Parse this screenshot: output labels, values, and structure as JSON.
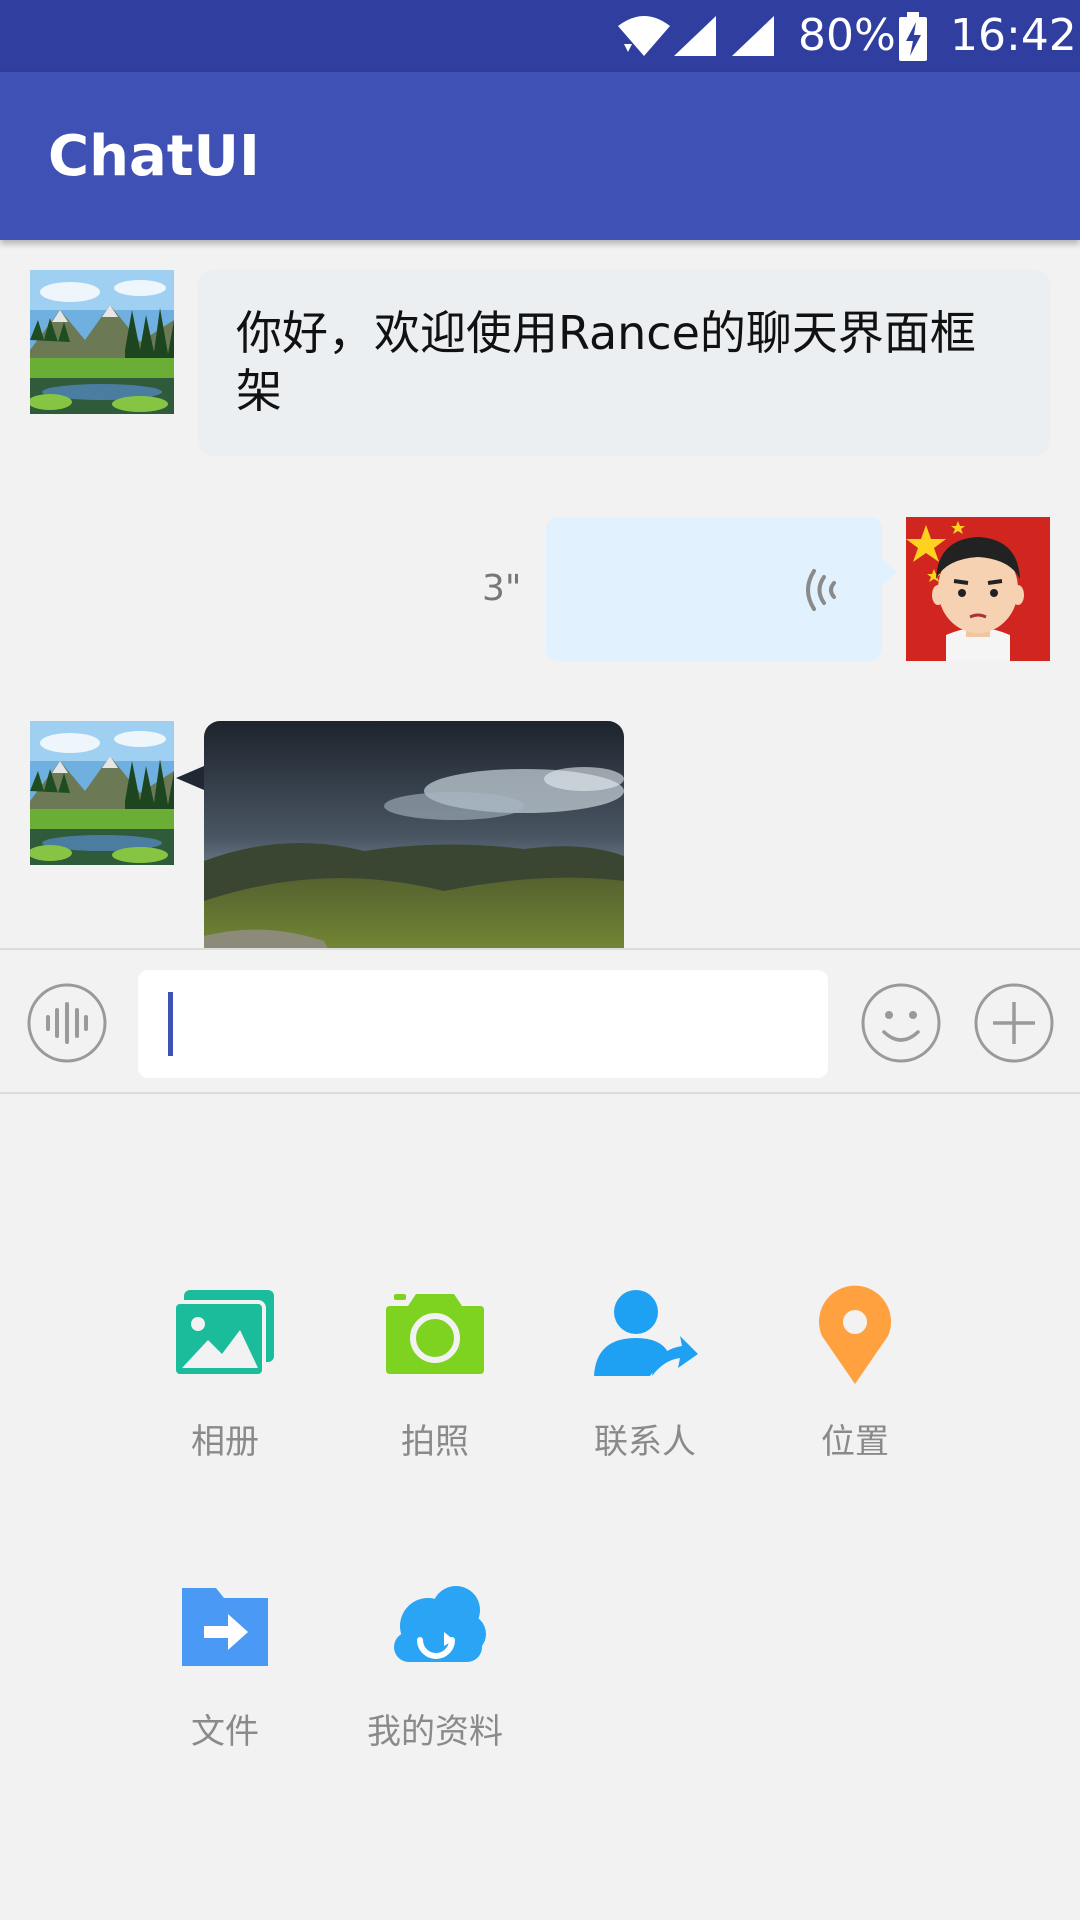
{
  "status_bar": {
    "battery": "80%",
    "time": "16:42",
    "icons": [
      "wifi-icon",
      "signal-icon",
      "signal-icon",
      "battery-charging-icon"
    ]
  },
  "app_bar": {
    "title": "ChatUI",
    "color": "#3f51b5",
    "status_color": "#303f9f"
  },
  "messages": [
    {
      "type": "text",
      "side": "left",
      "avatar": "landscape-avatar",
      "text": "你好，欢迎使用Rance的聊天界面框架"
    },
    {
      "type": "voice",
      "side": "right",
      "avatar": "cartoon-avatar",
      "duration": "3\""
    },
    {
      "type": "image",
      "side": "left",
      "avatar": "landscape-avatar",
      "image": "cloudy-valley-photo"
    }
  ],
  "input_bar": {
    "voice_icon": "voice-wave-icon",
    "emoji_icon": "emoji-icon",
    "more_icon": "plus-icon",
    "value": ""
  },
  "actions": [
    {
      "label": "相册",
      "icon": "album-icon",
      "color": "#1abc9c"
    },
    {
      "label": "拍照",
      "icon": "camera-icon",
      "color": "#7ed321"
    },
    {
      "label": "联系人",
      "icon": "contact-icon",
      "color": "#1ea1f2"
    },
    {
      "label": "位置",
      "icon": "location-icon",
      "color": "#ffa13f"
    },
    {
      "label": "文件",
      "icon": "file-icon",
      "color": "#4a9af5"
    },
    {
      "label": "我的资料",
      "icon": "cloud-icon",
      "color": "#2aa4f4"
    }
  ]
}
